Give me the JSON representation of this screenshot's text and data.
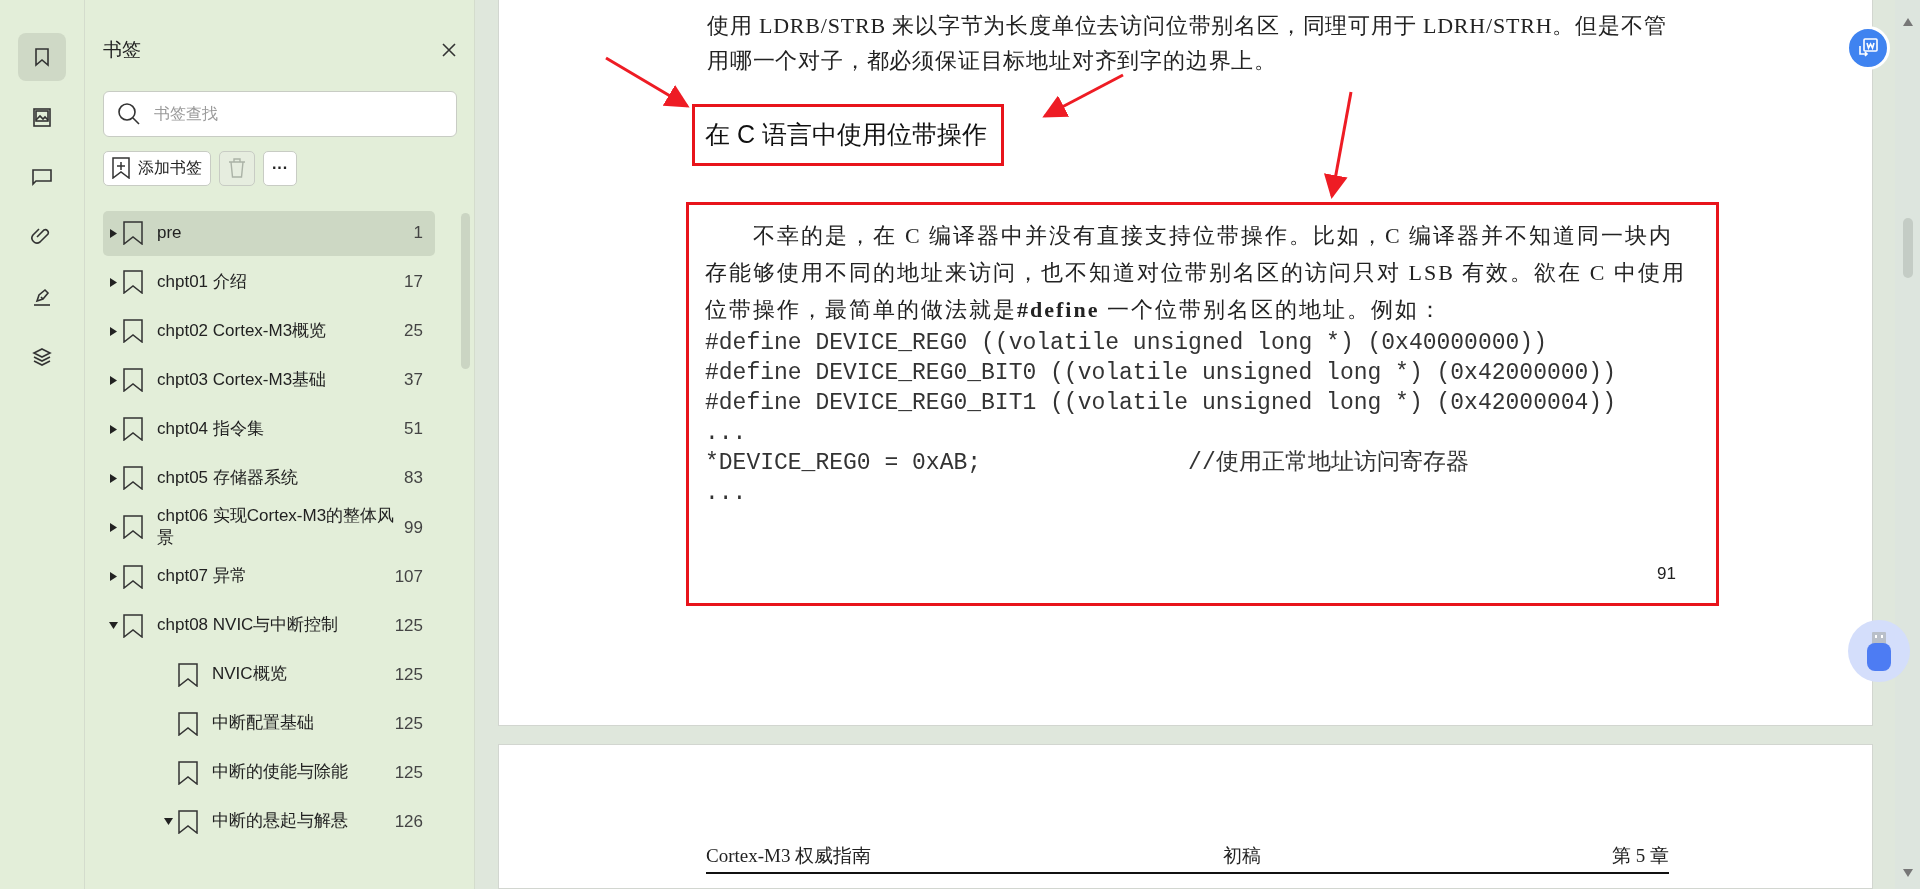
{
  "rail": [
    {
      "kind": "bookmark",
      "selected": true
    },
    {
      "kind": "image",
      "selected": false
    },
    {
      "kind": "comment",
      "selected": false
    },
    {
      "kind": "attachment",
      "selected": false
    },
    {
      "kind": "sign",
      "selected": false
    },
    {
      "kind": "layers",
      "selected": false
    }
  ],
  "sidebar": {
    "title": "书签",
    "search": {
      "placeholder": "书签查找"
    },
    "add_button": "添加书签",
    "delete_disabled": true,
    "more_button": "···",
    "items": [
      {
        "title": "pre",
        "page": "1",
        "expanded": false,
        "selected": true
      },
      {
        "title": "chpt01  介绍",
        "page": "17",
        "expanded": false,
        "selected": false
      },
      {
        "title": "chpt02  Cortex-M3概览",
        "page": "25",
        "expanded": false,
        "selected": false
      },
      {
        "title": "chpt03  Cortex-M3基础",
        "page": "37",
        "expanded": false,
        "selected": false
      },
      {
        "title": "chpt04  指令集",
        "page": "51",
        "expanded": false,
        "selected": false
      },
      {
        "title": "chpt05  存储器系统",
        "page": "83",
        "expanded": false,
        "selected": false
      },
      {
        "title": "chpt06  实现Cortex-M3的整体风景",
        "page": "99",
        "expanded": false,
        "selected": false
      },
      {
        "title": "chpt07  异常",
        "page": "107",
        "expanded": false,
        "selected": false
      },
      {
        "title": "chpt08  NVIC与中断控制",
        "page": "125",
        "expanded": true,
        "selected": false,
        "children": [
          {
            "kind": "leaf",
            "title": "NVIC概览",
            "page": "125",
            "selected": false
          },
          {
            "kind": "leaf",
            "title": "中断配置基础",
            "page": "125",
            "selected": false
          },
          {
            "kind": "leaf",
            "title": "中断的使能与除能",
            "page": "125",
            "selected": false
          },
          {
            "kind": "branch",
            "title": "中断的悬起与解悬",
            "page": "126",
            "expanded": true,
            "selected": false
          }
        ]
      }
    ]
  },
  "page": {
    "top_text": "使用 LDRB/STRB 来以字节为长度单位去访问位带别名区，同理可用于 LDRH/STRH。但是不管用哪一个对子，都必须保证目标地址对齐到字的边界上。",
    "heading": "在 C 语言中使用位带操作",
    "body": [
      {
        "kind": "text",
        "text": "不幸的是，在 C 编译器中并没有直接支持位带操作。比如，C 编译器并不知道同一块内存能够使用不同的地址来访问，也不知道对位带别名区的访问只对 LSB 有效。欲在 C 中使用位带操作，最简单的做法就是**#define** 一个位带别名区的地址。例如："
      },
      {
        "kind": "code",
        "text": "#define DEVICE_REG0 ((volatile unsigned long *) (0x40000000))"
      },
      {
        "kind": "code",
        "text": "#define DEVICE_REG0_BIT0 ((volatile unsigned long *) (0x42000000))"
      },
      {
        "kind": "code",
        "text": "#define DEVICE_REG0_BIT1 ((volatile unsigned long *) (0x42000004))"
      },
      {
        "kind": "code",
        "text": "..."
      },
      {
        "kind": "code",
        "text": "*DEVICE_REG0 = 0xAB;               //使用正常地址访问寄存器"
      },
      {
        "kind": "code",
        "text": "..."
      }
    ],
    "page_number": "91"
  },
  "next_page": {
    "header_left": "Cortex-M3 权威指南",
    "header_center": "初稿",
    "header_right": "第 5 章"
  }
}
